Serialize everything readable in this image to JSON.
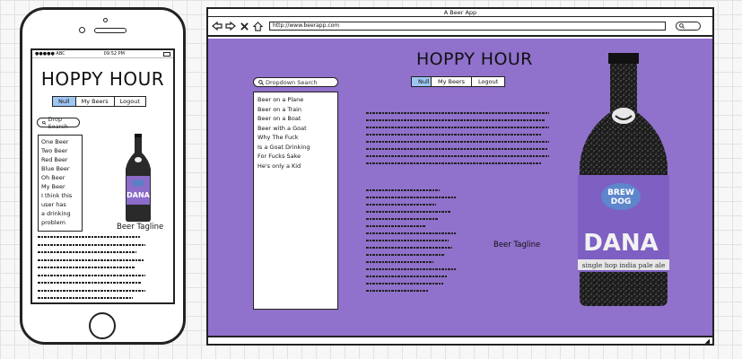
{
  "phone": {
    "status": {
      "carrier": "●●●●● ABC",
      "time": "09:52 PM"
    },
    "title": "HOPPY HOUR",
    "tabs": [
      "Null",
      "My Beers",
      "Logout"
    ],
    "search_placeholder": "Drop Search",
    "list": [
      "One Beer",
      "Two Beer",
      "Red Beer",
      "Blue Beer",
      "Oh Beer",
      "My Beer",
      "I think this",
      "user has",
      "a drinking",
      "problem"
    ],
    "tagline": "Beer Tagline"
  },
  "browser": {
    "window_title": "A Beer App",
    "url": "http://www.beerapp.com",
    "title": "HOPPY HOUR",
    "tabs": [
      "Null",
      "My Beers",
      "Logout"
    ],
    "search_placeholder": "Dropdown Search",
    "list": [
      "Beer on a Plane",
      "Beer on a Train",
      "Beer on a Boat",
      "Beer with a Goat",
      "Why The Fuck",
      "Is a Goat Drinking",
      "For Fucks Sake",
      "He's only a Kid"
    ],
    "tagline": "Beer Tagline",
    "bottle_label": {
      "brand_line1": "BREW",
      "brand_line2": "DOG",
      "name": "DANA",
      "style": "single hop india pale ale"
    }
  },
  "colors": {
    "content_bg": "#9071cb",
    "active_tab": "#9ec6f3",
    "bottle_label": "#7e5fc2"
  }
}
